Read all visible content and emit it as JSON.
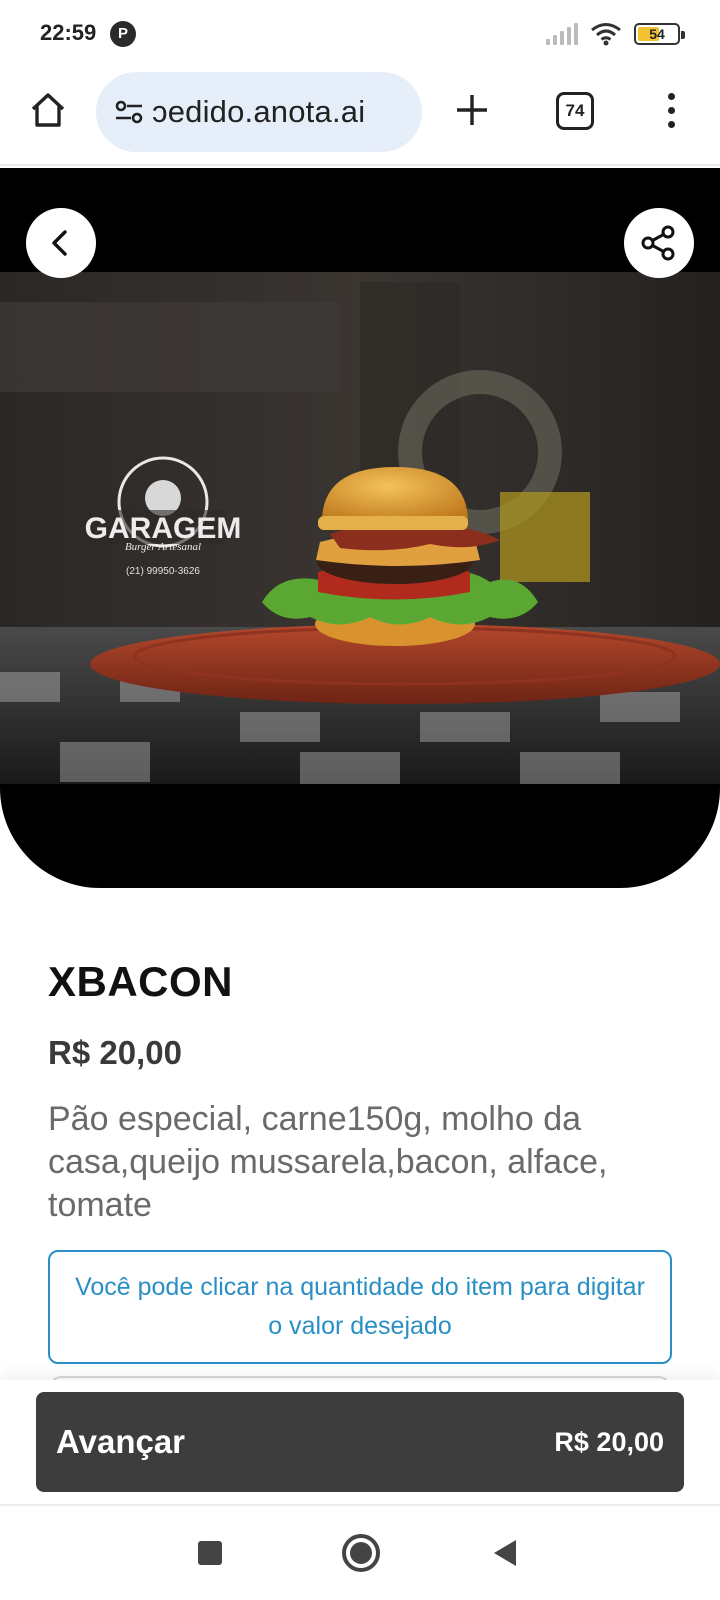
{
  "status_bar": {
    "time": "22:59",
    "app_badge": "P",
    "battery_level": "54",
    "battery_fraction": 0.54
  },
  "browser": {
    "url": "ɔedido.anota.ai",
    "tab_count": "74",
    "icons": [
      "home-icon",
      "tune-icon",
      "plus-icon",
      "tabs-icon",
      "more-vert-icon"
    ]
  },
  "hero": {
    "logo_text": "GARAGEM",
    "logo_subtext": "Burger Artesanal",
    "logo_phone": "(21) 99950-3626",
    "icons": [
      "back-icon",
      "share-icon"
    ]
  },
  "product": {
    "title": "XBACON",
    "price": "R$ 20,00",
    "description": "Pão especial, carne150g, molho da casa,queijo mussarela,bacon, alface, tomate"
  },
  "notice": {
    "text": "Você pode clicar na quantidade do item para digitar o valor desejado"
  },
  "footer": {
    "advance_label": "Avançar",
    "total": "R$ 20,00"
  },
  "colors": {
    "accent": "#2a8fc4",
    "button_bg": "#3d3d3d",
    "url_pill": "#e6eefa"
  }
}
